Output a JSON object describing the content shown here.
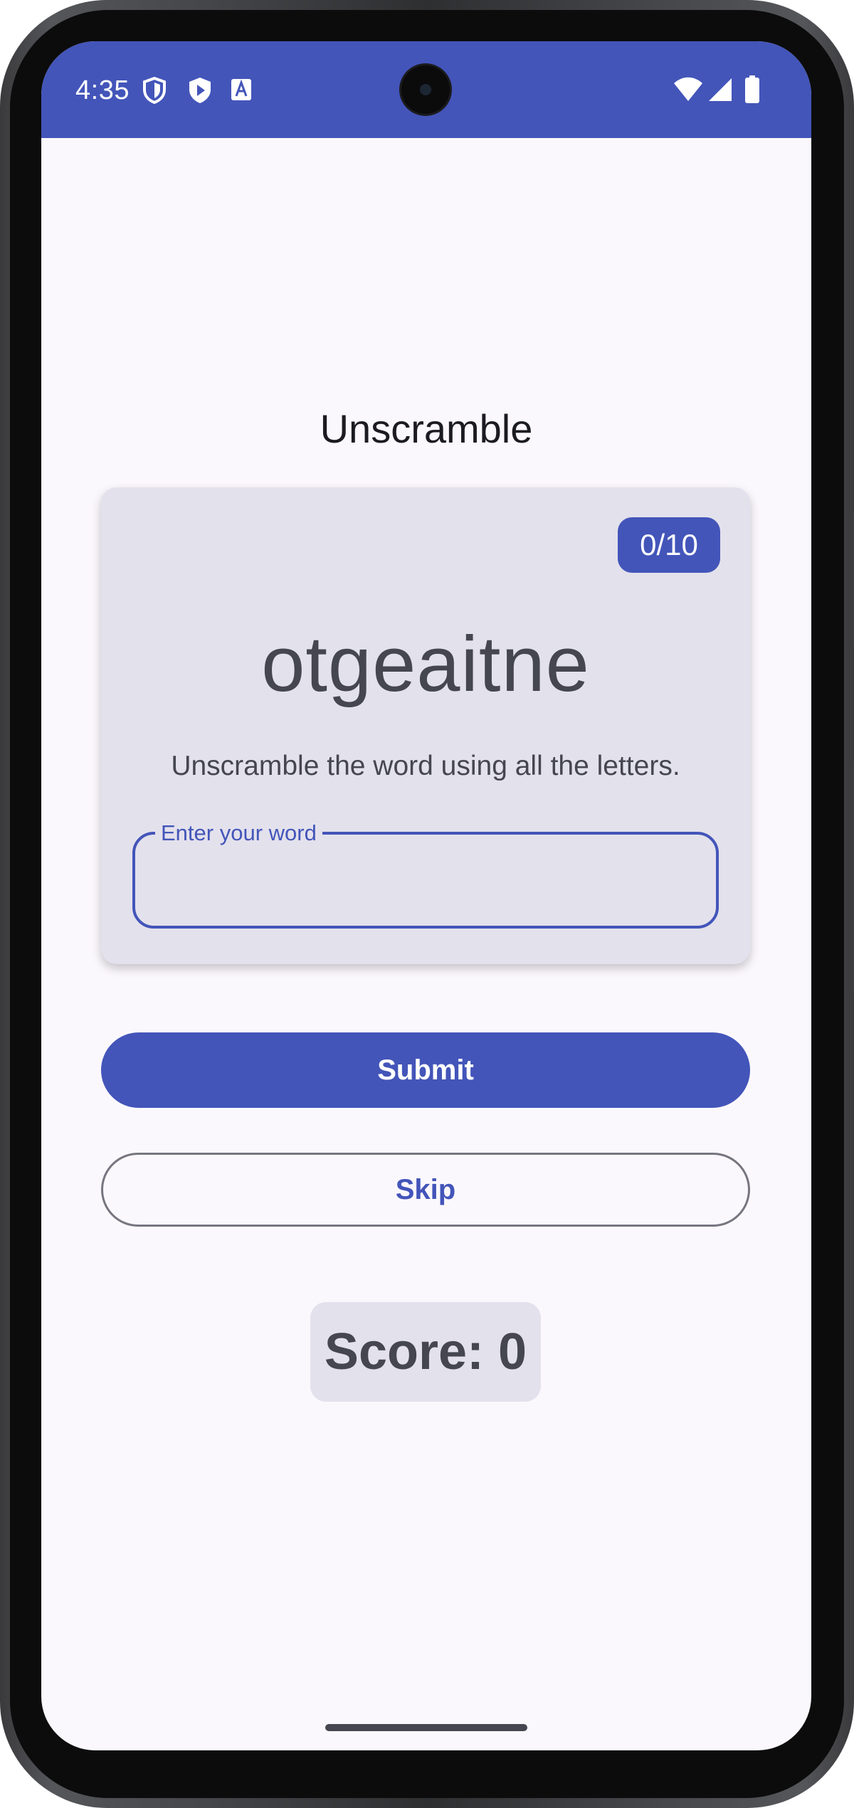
{
  "status_bar": {
    "time": "4:35",
    "left_icons": [
      "shield-outline-icon",
      "play-protect-icon",
      "font-app-icon"
    ],
    "right_icons": [
      "wifi-icon",
      "signal-icon",
      "battery-icon"
    ],
    "background_color": "#4355b9"
  },
  "app": {
    "title": "Unscramble"
  },
  "game": {
    "word_count": "0/10",
    "scrambled_word": "otgeaitne",
    "instruction": "Unscramble the word using all the letters.",
    "input_label": "Enter your word",
    "input_value": ""
  },
  "actions": {
    "submit_label": "Submit",
    "skip_label": "Skip"
  },
  "score": {
    "text": "Score: 0"
  },
  "colors": {
    "primary": "#4355b9",
    "surface": "#fbf8fd",
    "card": "#e3e1ec",
    "on_surface_variant": "#45464f",
    "outline": "#767680"
  }
}
